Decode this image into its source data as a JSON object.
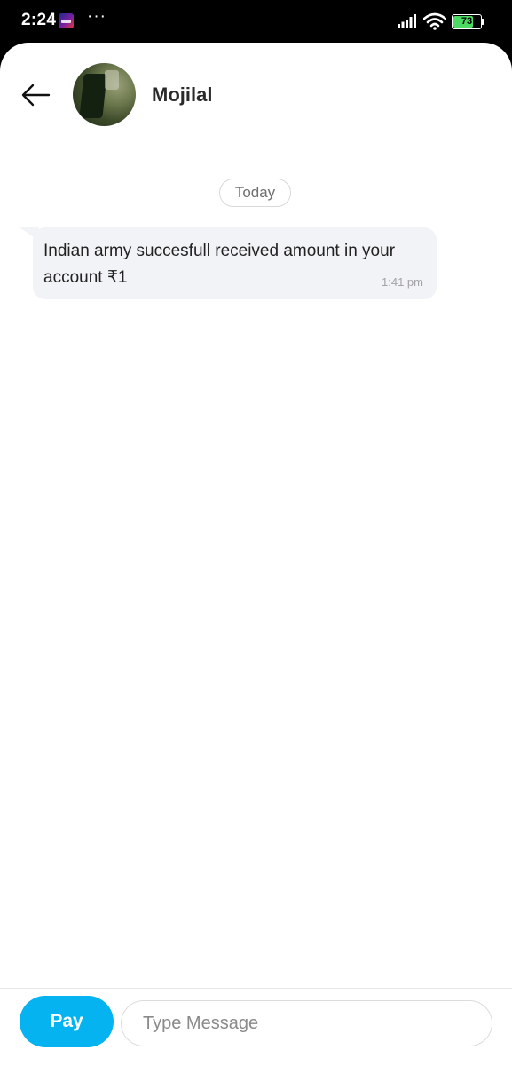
{
  "status_bar": {
    "time": "2:24",
    "more_indicator": "···",
    "battery_percent": "73",
    "battery_level": 0.73,
    "battery_color": "#4cd964",
    "icons": [
      "sony-liv-app-icon",
      "signal-icon",
      "wifi-icon",
      "battery-icon"
    ]
  },
  "header": {
    "back_icon": "arrow-left-icon",
    "contact_name": "Mojilal"
  },
  "messages": {
    "date_label": "Today",
    "items": [
      {
        "text": "Indian army succesfull received amount in your account ₹1",
        "time": "1:41 pm"
      }
    ]
  },
  "composer": {
    "pay_label": "Pay",
    "input_placeholder": "Type Message",
    "input_value": "",
    "accent_color": "#05b3f1"
  }
}
